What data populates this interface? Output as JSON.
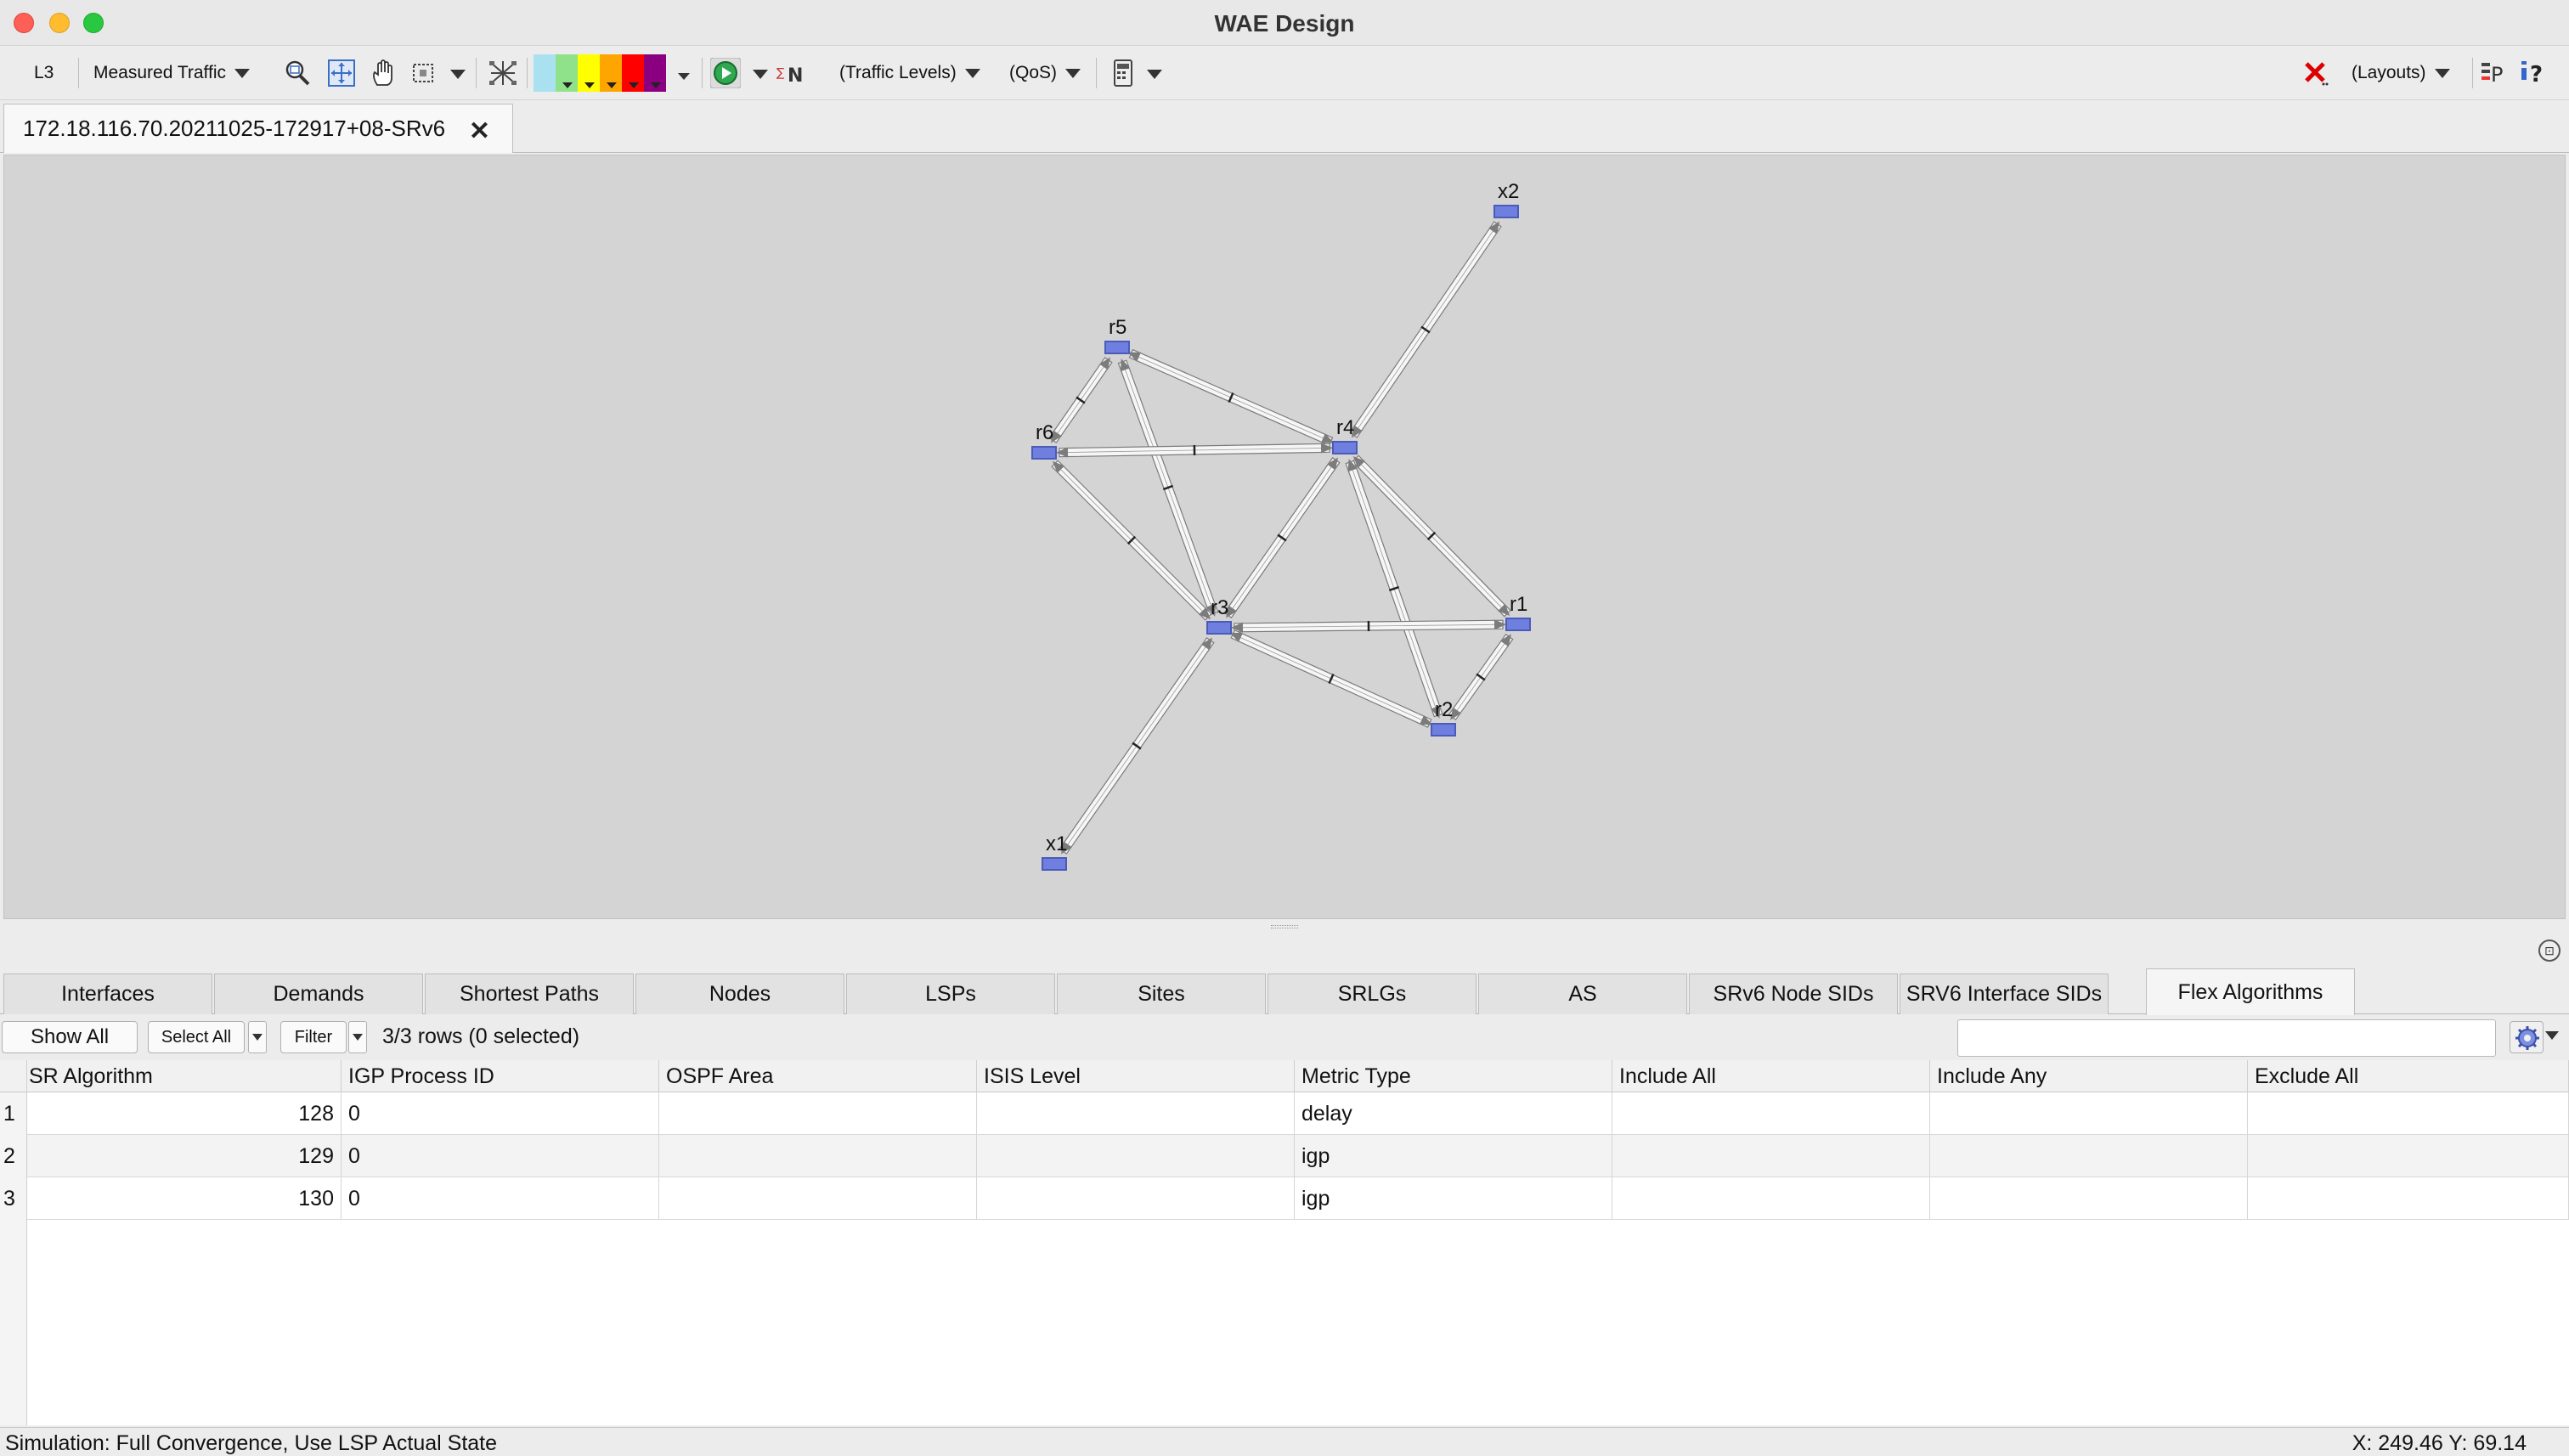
{
  "app": {
    "title": "WAE Design"
  },
  "toolbar": {
    "layer_label": "L3",
    "traffic_select": "Measured Traffic",
    "traffic_levels_select": "(Traffic Levels)",
    "qos_select": "(QoS)",
    "layouts_select": "(Layouts)",
    "utilization_colors": [
      "#a9e1f0",
      "#8fe28a",
      "#ffff00",
      "#ffa500",
      "#ff0000",
      "#8b0080"
    ]
  },
  "document_tab": {
    "label": "172.18.116.70.20211025-172917+08-SRv6",
    "close_glyph": "✕"
  },
  "topology": {
    "nodes": [
      {
        "id": "x2",
        "label": "x2"
      },
      {
        "id": "r5",
        "label": "r5"
      },
      {
        "id": "r6",
        "label": "r6"
      },
      {
        "id": "r4",
        "label": "r4"
      },
      {
        "id": "r3",
        "label": "r3"
      },
      {
        "id": "r1",
        "label": "r1"
      },
      {
        "id": "r2",
        "label": "r2"
      },
      {
        "id": "x1",
        "label": "x1"
      }
    ],
    "links": [
      [
        "x2",
        "r4"
      ],
      [
        "r5",
        "r6"
      ],
      [
        "r5",
        "r4"
      ],
      [
        "r5",
        "r3"
      ],
      [
        "r6",
        "r4"
      ],
      [
        "r6",
        "r3"
      ],
      [
        "r4",
        "r3"
      ],
      [
        "r4",
        "r1"
      ],
      [
        "r4",
        "r2"
      ],
      [
        "r3",
        "r1"
      ],
      [
        "r3",
        "r2"
      ],
      [
        "r1",
        "r2"
      ],
      [
        "r3",
        "x1"
      ]
    ],
    "node_color": "#6f7fe0"
  },
  "tabs": [
    {
      "label": "Interfaces"
    },
    {
      "label": "Demands"
    },
    {
      "label": "Shortest Paths"
    },
    {
      "label": "Nodes"
    },
    {
      "label": "LSPs"
    },
    {
      "label": "Sites"
    },
    {
      "label": "SRLGs"
    },
    {
      "label": "AS"
    },
    {
      "label": "SRv6 Node SIDs"
    },
    {
      "label": "SRV6 Interface SIDs"
    },
    {
      "label": "Flex Algorithms",
      "active": true
    }
  ],
  "table_toolbar": {
    "show_all": "Show All",
    "select_all": "Select All",
    "filter": "Filter",
    "row_count": "3/3 rows (0 selected)",
    "search_value": ""
  },
  "table": {
    "columns": [
      "SR Algorithm",
      "IGP Process ID",
      "OSPF Area",
      "ISIS Level",
      "Metric Type",
      "Include All",
      "Include Any",
      "Exclude All"
    ],
    "rows": [
      {
        "num": "1",
        "cells": [
          "128",
          "0",
          "",
          "",
          "delay",
          "",
          "",
          ""
        ]
      },
      {
        "num": "2",
        "cells": [
          "129",
          "0",
          "",
          "",
          "igp",
          "",
          "",
          ""
        ]
      },
      {
        "num": "3",
        "cells": [
          "130",
          "0",
          "",
          "",
          "igp",
          "",
          "",
          ""
        ]
      }
    ]
  },
  "status": {
    "left": "Simulation: Full Convergence, Use LSP Actual State",
    "right": "X: 249.46  Y: 69.14"
  }
}
